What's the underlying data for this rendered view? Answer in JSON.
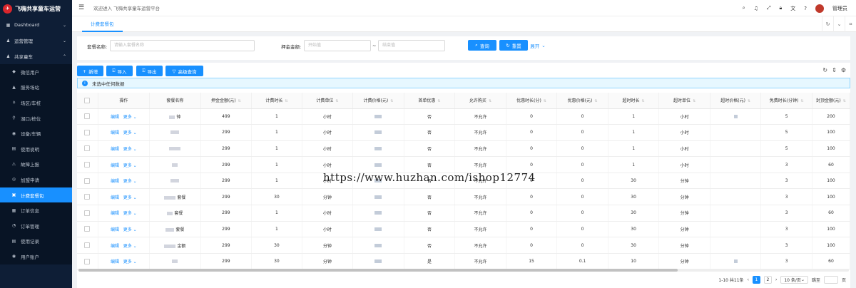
{
  "sidebar": {
    "brand": "飞嗨共享童车运营",
    "items": [
      {
        "label": "Dashboard",
        "type": "top",
        "arrow": "⌄",
        "icon": "grid-icon"
      },
      {
        "label": "运营管理",
        "type": "top",
        "arrow": "⌄",
        "icon": "person-icon"
      },
      {
        "label": "共享童车",
        "type": "top",
        "arrow": "⌃",
        "icon": "person-icon"
      },
      {
        "label": "微信用户",
        "type": "sub",
        "icon": "tag-icon"
      },
      {
        "label": "服务场站",
        "type": "sub",
        "icon": "building-icon"
      },
      {
        "label": "场区/车桩",
        "type": "sub",
        "icon": "bank-icon"
      },
      {
        "label": "湖口/桩位",
        "type": "sub",
        "icon": "link-icon"
      },
      {
        "label": "设备/车辆",
        "type": "sub",
        "icon": "car-icon"
      },
      {
        "label": "使用说明",
        "type": "sub",
        "icon": "doc-icon"
      },
      {
        "label": "故障上报",
        "type": "sub",
        "icon": "warning-icon"
      },
      {
        "label": "加盟申请",
        "type": "sub",
        "icon": "coin-icon"
      },
      {
        "label": "计费套餐包",
        "type": "sub",
        "icon": "package-icon",
        "active": true
      },
      {
        "label": "订单信息",
        "type": "sub",
        "icon": "order-icon"
      },
      {
        "label": "订单管理",
        "type": "sub",
        "icon": "order-manage-icon"
      },
      {
        "label": "使用记录",
        "type": "sub",
        "icon": "record-icon"
      },
      {
        "label": "用户账户",
        "type": "sub",
        "icon": "account-icon"
      }
    ]
  },
  "header": {
    "welcome": "欢迎进入 飞嗨共享童车运营平台",
    "user": "管理员"
  },
  "tabs": [
    {
      "label": "计费套餐包"
    }
  ],
  "search": {
    "name_label": "套餐名称:",
    "name_placeholder": "请输入套餐名称",
    "deposit_label": "押金金额:",
    "start_placeholder": "开始值",
    "range_sep": "~",
    "end_placeholder": "结束值",
    "query": "查询",
    "reset": "重置",
    "expand": "展开"
  },
  "toolbar": {
    "add": "新增",
    "import": "导入",
    "export": "导出",
    "advanced": "高级查询"
  },
  "alert": "未选中任何数据",
  "columns": [
    "操作",
    "套餐名称",
    "押金金额(元)",
    "计费时长",
    "计费单位",
    "计费价格(元)",
    "首单优惠",
    "允许购买",
    "优惠时长(分)",
    "优惠价格(元)",
    "超时时长",
    "超时单位",
    "超时价格(元)",
    "免费时长(分钟)",
    "封顶金额(元)"
  ],
  "row_actions": {
    "edit": "编辑",
    "more": "更多"
  },
  "rows": [
    {
      "name_visible": "钟",
      "deposit": "499",
      "duration": "1",
      "unit": "小时",
      "first": "否",
      "allow": "不允许",
      "disc_dur": "0",
      "disc_price": "0",
      "over_dur": "1",
      "over_unit": "小时",
      "free": "5",
      "cap": "200"
    },
    {
      "name_visible": "",
      "deposit": "299",
      "duration": "1",
      "unit": "小时",
      "first": "否",
      "allow": "不允许",
      "disc_dur": "0",
      "disc_price": "0",
      "over_dur": "1",
      "over_unit": "小时",
      "free": "5",
      "cap": "100"
    },
    {
      "name_visible": "",
      "deposit": "299",
      "duration": "1",
      "unit": "小时",
      "first": "否",
      "allow": "不允许",
      "disc_dur": "0",
      "disc_price": "0",
      "over_dur": "1",
      "over_unit": "小时",
      "free": "5",
      "cap": "100"
    },
    {
      "name_visible": "",
      "deposit": "299",
      "duration": "1",
      "unit": "小时",
      "first": "否",
      "allow": "不允许",
      "disc_dur": "0",
      "disc_price": "0",
      "over_dur": "1",
      "over_unit": "小时",
      "free": "3",
      "cap": "60"
    },
    {
      "name_visible": "",
      "deposit": "299",
      "duration": "1",
      "unit": "小时",
      "first": "否",
      "allow": "不允许",
      "disc_dur": "0",
      "disc_price": "0",
      "over_dur": "30",
      "over_unit": "分钟",
      "free": "3",
      "cap": "100"
    },
    {
      "name_visible": "套餐",
      "deposit": "299",
      "duration": "30",
      "unit": "分钟",
      "first": "否",
      "allow": "不允许",
      "disc_dur": "0",
      "disc_price": "0",
      "over_dur": "30",
      "over_unit": "分钟",
      "free": "3",
      "cap": "100"
    },
    {
      "name_visible": "套餐",
      "deposit": "299",
      "duration": "1",
      "unit": "小时",
      "first": "否",
      "allow": "不允许",
      "disc_dur": "0",
      "disc_price": "0",
      "over_dur": "30",
      "over_unit": "分钟",
      "free": "3",
      "cap": "60"
    },
    {
      "name_visible": "套餐",
      "deposit": "299",
      "duration": "1",
      "unit": "小时",
      "first": "否",
      "allow": "不允许",
      "disc_dur": "0",
      "disc_price": "0",
      "over_dur": "30",
      "over_unit": "分钟",
      "free": "3",
      "cap": "100"
    },
    {
      "name_visible": "金额",
      "deposit": "299",
      "duration": "30",
      "unit": "分钟",
      "first": "否",
      "allow": "不允许",
      "disc_dur": "0",
      "disc_price": "0",
      "over_dur": "30",
      "over_unit": "分钟",
      "free": "3",
      "cap": "100"
    },
    {
      "name_visible": "",
      "deposit": "299",
      "duration": "30",
      "unit": "分钟",
      "first": "是",
      "allow": "不允许",
      "disc_dur": "15",
      "disc_price": "0.1",
      "over_dur": "10",
      "over_unit": "分钟",
      "free": "3",
      "cap": "60"
    }
  ],
  "pager": {
    "summary": "1-10 共11条",
    "pages": [
      "1",
      "2"
    ],
    "prev": "‹",
    "next": "›",
    "size": "10 条/页",
    "goto": "跳至",
    "page_unit": "页"
  },
  "watermark": "https://www.huzhan.com/ishop12774",
  "colors": {
    "sidebar": "#0e1e36",
    "accent": "#1890ff"
  }
}
